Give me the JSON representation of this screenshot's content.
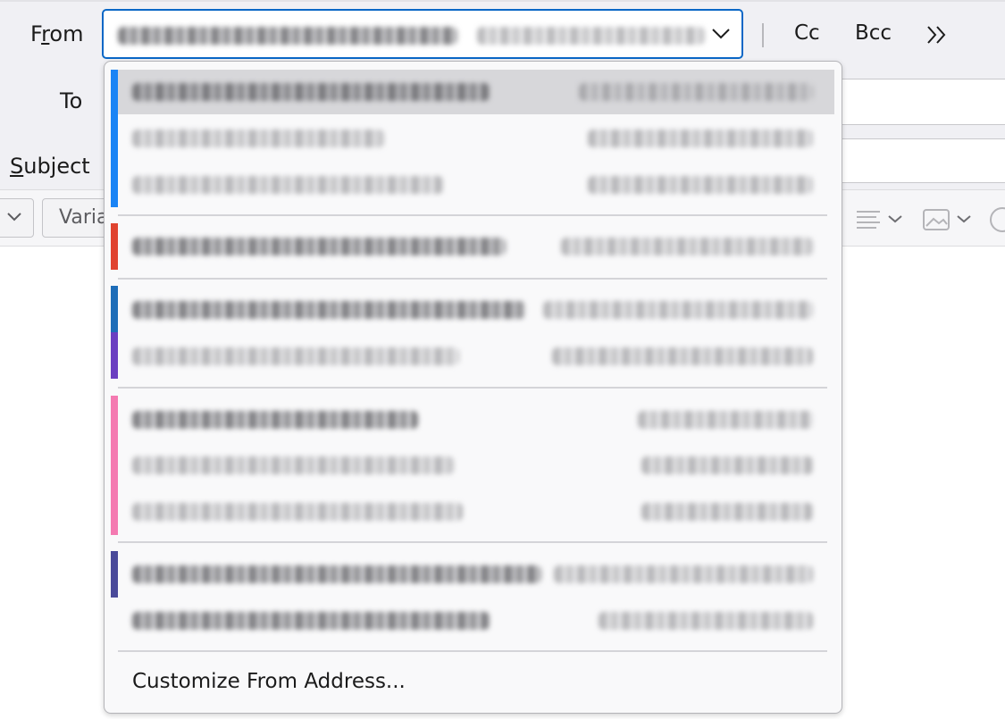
{
  "labels": {
    "from": "From",
    "from_prefix": "F",
    "from_access": "r",
    "from_rest": "om",
    "to": "To",
    "subject_access": "S",
    "subject_rest": "ubject"
  },
  "header_buttons": {
    "cc": "Cc",
    "bcc": "Bcc",
    "more_icon": "double-chevron-right-icon"
  },
  "toolbar": {
    "font_select_value": "Varia"
  },
  "from_dropdown": {
    "customize_label": "Customize From Address...",
    "groups": [
      {
        "accent": "#1a84f5",
        "items": 3
      },
      {
        "accent": "#e0432f",
        "items": 1
      },
      {
        "accent": "#1e6db8",
        "accent2": "#6b3fc1",
        "items": 2
      },
      {
        "accent": "#f47ab1",
        "items": 3
      },
      {
        "accent": "#4a4a9a",
        "items": 2
      }
    ]
  },
  "colors": {
    "focus_border": "#0a67c6",
    "header_bg": "#f0f0f4",
    "highlight": "#d7d7da"
  }
}
